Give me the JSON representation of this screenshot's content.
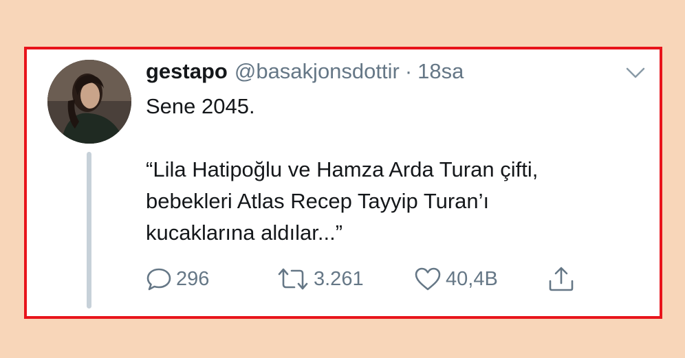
{
  "tweet": {
    "display_name": "gestapo",
    "handle": "@basakjonsdottir",
    "separator": "·",
    "time": "18sa",
    "text_lines": [
      "Sene 2045.",
      "“Lila Hatipoğlu ve Hamza Arda Turan çifti,",
      "bebekleri Atlas Recep Tayyip Turan’ı",
      "kucaklarına aldılar...”"
    ],
    "actions": {
      "reply_count": "296",
      "retweet_count": "3.261",
      "like_count": "40,4B"
    }
  },
  "icons": {
    "reply": "speech-bubble-icon",
    "retweet": "retweet-arrows-icon",
    "like": "heart-icon",
    "share": "share-upload-icon",
    "more": "chevron-down-icon"
  },
  "colors": {
    "background": "#f8d6b9",
    "frame_border": "#e8141b",
    "text_primary": "#14171a",
    "text_secondary": "#657786",
    "thread_line": "#c7d1d9"
  }
}
